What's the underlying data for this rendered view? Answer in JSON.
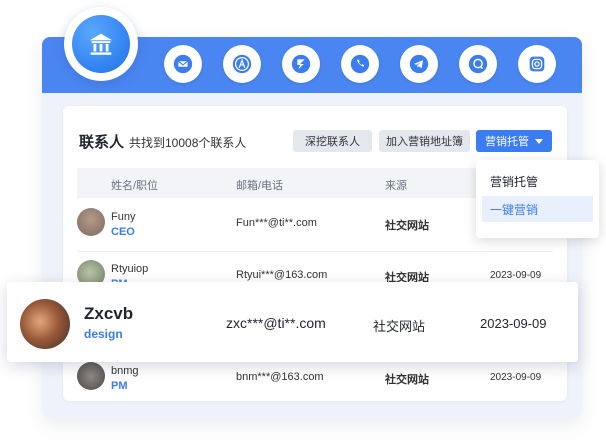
{
  "social_icons": [
    "mail-icon",
    "app-store-icon",
    "telegram-bolt-icon",
    "phone-icon",
    "telegram-plane-icon",
    "chat-bubble-icon",
    "instagram-icon"
  ],
  "logo": {
    "icon": "bank-building-icon"
  },
  "contacts": {
    "title": "联系人",
    "summary": "共找到10008个联系人",
    "buttons": {
      "deep_contact": "深挖联系人",
      "add_to_list": "加入营销地址簿",
      "marketing": "营销托管"
    },
    "columns": {
      "name_role": "姓名/职位",
      "email_phone": "邮箱/电话",
      "source": "来源"
    },
    "rows": [
      {
        "name": "Funy",
        "role": "CEO",
        "email": "Fun***@ti**.com",
        "source": "社交网站",
        "date": ""
      },
      {
        "name": "Rtyuiop",
        "role": "PM",
        "email": "Rtyui***@163.com",
        "source": "社交网站",
        "date": "2023-09-09"
      },
      {
        "name": "bnmg",
        "role": "PM",
        "email": "bnm***@163.com",
        "source": "社交网站",
        "date": "2023-09-09"
      }
    ],
    "highlighted": {
      "name": "Zxcvb",
      "role": "design",
      "email": "zxc***@ti**.com",
      "source": "社交网站",
      "date": "2023-09-09"
    }
  },
  "dropdown": {
    "items": [
      "营销托管",
      "一键营销"
    ],
    "active_index": 1
  },
  "colors": {
    "primary": "#3b7cf0",
    "topbar": "#4a86f2"
  }
}
